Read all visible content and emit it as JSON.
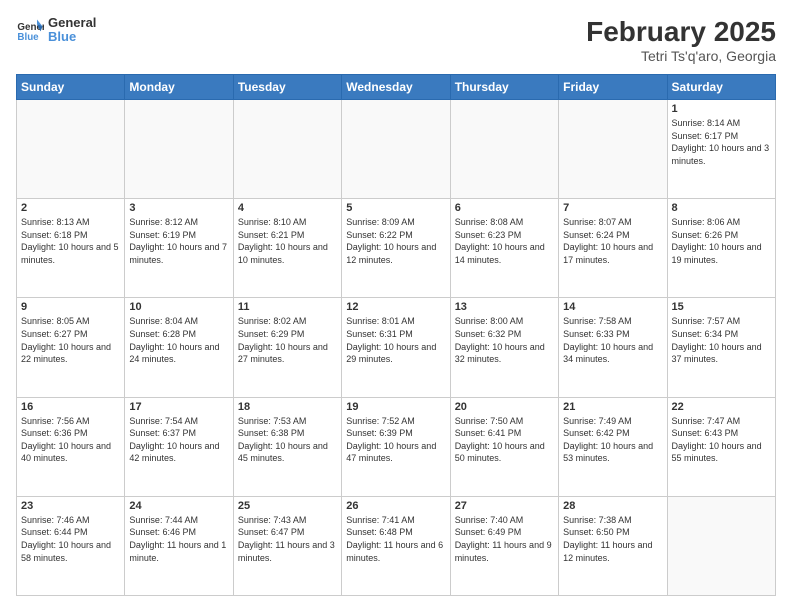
{
  "logo": {
    "line1": "General",
    "line2": "Blue"
  },
  "title": "February 2025",
  "location": "Tetri Ts'q'aro, Georgia",
  "weekdays": [
    "Sunday",
    "Monday",
    "Tuesday",
    "Wednesday",
    "Thursday",
    "Friday",
    "Saturday"
  ],
  "weeks": [
    [
      {
        "day": "",
        "info": ""
      },
      {
        "day": "",
        "info": ""
      },
      {
        "day": "",
        "info": ""
      },
      {
        "day": "",
        "info": ""
      },
      {
        "day": "",
        "info": ""
      },
      {
        "day": "",
        "info": ""
      },
      {
        "day": "1",
        "info": "Sunrise: 8:14 AM\nSunset: 6:17 PM\nDaylight: 10 hours and 3 minutes."
      }
    ],
    [
      {
        "day": "2",
        "info": "Sunrise: 8:13 AM\nSunset: 6:18 PM\nDaylight: 10 hours and 5 minutes."
      },
      {
        "day": "3",
        "info": "Sunrise: 8:12 AM\nSunset: 6:19 PM\nDaylight: 10 hours and 7 minutes."
      },
      {
        "day": "4",
        "info": "Sunrise: 8:10 AM\nSunset: 6:21 PM\nDaylight: 10 hours and 10 minutes."
      },
      {
        "day": "5",
        "info": "Sunrise: 8:09 AM\nSunset: 6:22 PM\nDaylight: 10 hours and 12 minutes."
      },
      {
        "day": "6",
        "info": "Sunrise: 8:08 AM\nSunset: 6:23 PM\nDaylight: 10 hours and 14 minutes."
      },
      {
        "day": "7",
        "info": "Sunrise: 8:07 AM\nSunset: 6:24 PM\nDaylight: 10 hours and 17 minutes."
      },
      {
        "day": "8",
        "info": "Sunrise: 8:06 AM\nSunset: 6:26 PM\nDaylight: 10 hours and 19 minutes."
      }
    ],
    [
      {
        "day": "9",
        "info": "Sunrise: 8:05 AM\nSunset: 6:27 PM\nDaylight: 10 hours and 22 minutes."
      },
      {
        "day": "10",
        "info": "Sunrise: 8:04 AM\nSunset: 6:28 PM\nDaylight: 10 hours and 24 minutes."
      },
      {
        "day": "11",
        "info": "Sunrise: 8:02 AM\nSunset: 6:29 PM\nDaylight: 10 hours and 27 minutes."
      },
      {
        "day": "12",
        "info": "Sunrise: 8:01 AM\nSunset: 6:31 PM\nDaylight: 10 hours and 29 minutes."
      },
      {
        "day": "13",
        "info": "Sunrise: 8:00 AM\nSunset: 6:32 PM\nDaylight: 10 hours and 32 minutes."
      },
      {
        "day": "14",
        "info": "Sunrise: 7:58 AM\nSunset: 6:33 PM\nDaylight: 10 hours and 34 minutes."
      },
      {
        "day": "15",
        "info": "Sunrise: 7:57 AM\nSunset: 6:34 PM\nDaylight: 10 hours and 37 minutes."
      }
    ],
    [
      {
        "day": "16",
        "info": "Sunrise: 7:56 AM\nSunset: 6:36 PM\nDaylight: 10 hours and 40 minutes."
      },
      {
        "day": "17",
        "info": "Sunrise: 7:54 AM\nSunset: 6:37 PM\nDaylight: 10 hours and 42 minutes."
      },
      {
        "day": "18",
        "info": "Sunrise: 7:53 AM\nSunset: 6:38 PM\nDaylight: 10 hours and 45 minutes."
      },
      {
        "day": "19",
        "info": "Sunrise: 7:52 AM\nSunset: 6:39 PM\nDaylight: 10 hours and 47 minutes."
      },
      {
        "day": "20",
        "info": "Sunrise: 7:50 AM\nSunset: 6:41 PM\nDaylight: 10 hours and 50 minutes."
      },
      {
        "day": "21",
        "info": "Sunrise: 7:49 AM\nSunset: 6:42 PM\nDaylight: 10 hours and 53 minutes."
      },
      {
        "day": "22",
        "info": "Sunrise: 7:47 AM\nSunset: 6:43 PM\nDaylight: 10 hours and 55 minutes."
      }
    ],
    [
      {
        "day": "23",
        "info": "Sunrise: 7:46 AM\nSunset: 6:44 PM\nDaylight: 10 hours and 58 minutes."
      },
      {
        "day": "24",
        "info": "Sunrise: 7:44 AM\nSunset: 6:46 PM\nDaylight: 11 hours and 1 minute."
      },
      {
        "day": "25",
        "info": "Sunrise: 7:43 AM\nSunset: 6:47 PM\nDaylight: 11 hours and 3 minutes."
      },
      {
        "day": "26",
        "info": "Sunrise: 7:41 AM\nSunset: 6:48 PM\nDaylight: 11 hours and 6 minutes."
      },
      {
        "day": "27",
        "info": "Sunrise: 7:40 AM\nSunset: 6:49 PM\nDaylight: 11 hours and 9 minutes."
      },
      {
        "day": "28",
        "info": "Sunrise: 7:38 AM\nSunset: 6:50 PM\nDaylight: 11 hours and 12 minutes."
      },
      {
        "day": "",
        "info": ""
      }
    ]
  ]
}
